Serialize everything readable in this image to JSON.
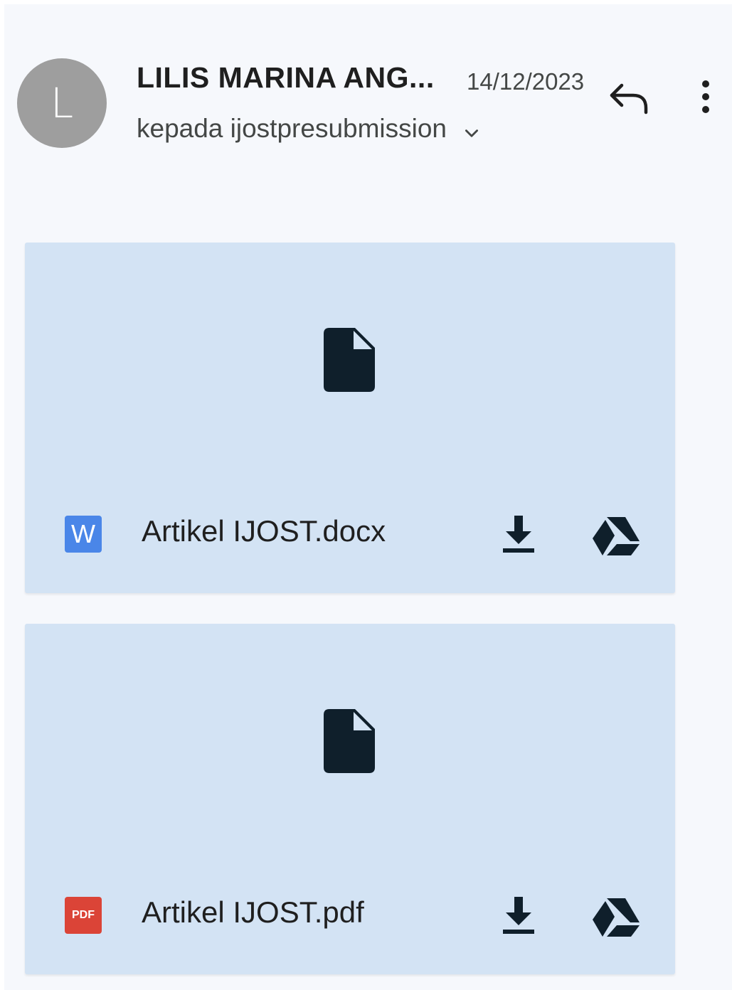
{
  "header": {
    "avatar_initial": "L",
    "sender_name": "LILIS MARINA ANG...",
    "date": "14/12/2023",
    "recipient_text": "kepada ijostpresubmission"
  },
  "icons": {
    "reply": "reply-icon",
    "more": "more-vert-icon",
    "chevron": "chevron-down-icon",
    "file": "file-icon",
    "download": "download-icon",
    "drive": "google-drive-icon"
  },
  "attachments": [
    {
      "filename": "Artikel IJOST.docx",
      "type_badge": "W",
      "type_icon": "word-icon",
      "badge_color": "#4a86e8"
    },
    {
      "filename": "Artikel IJOST.pdf",
      "type_badge": "PDF",
      "type_icon": "pdf-icon",
      "badge_color": "#db4437"
    }
  ],
  "colors": {
    "background": "#f6f8fc",
    "attachment_card": "#d3e3f4",
    "avatar": "#9e9e9e",
    "icon_dark": "#0f1f2b"
  }
}
